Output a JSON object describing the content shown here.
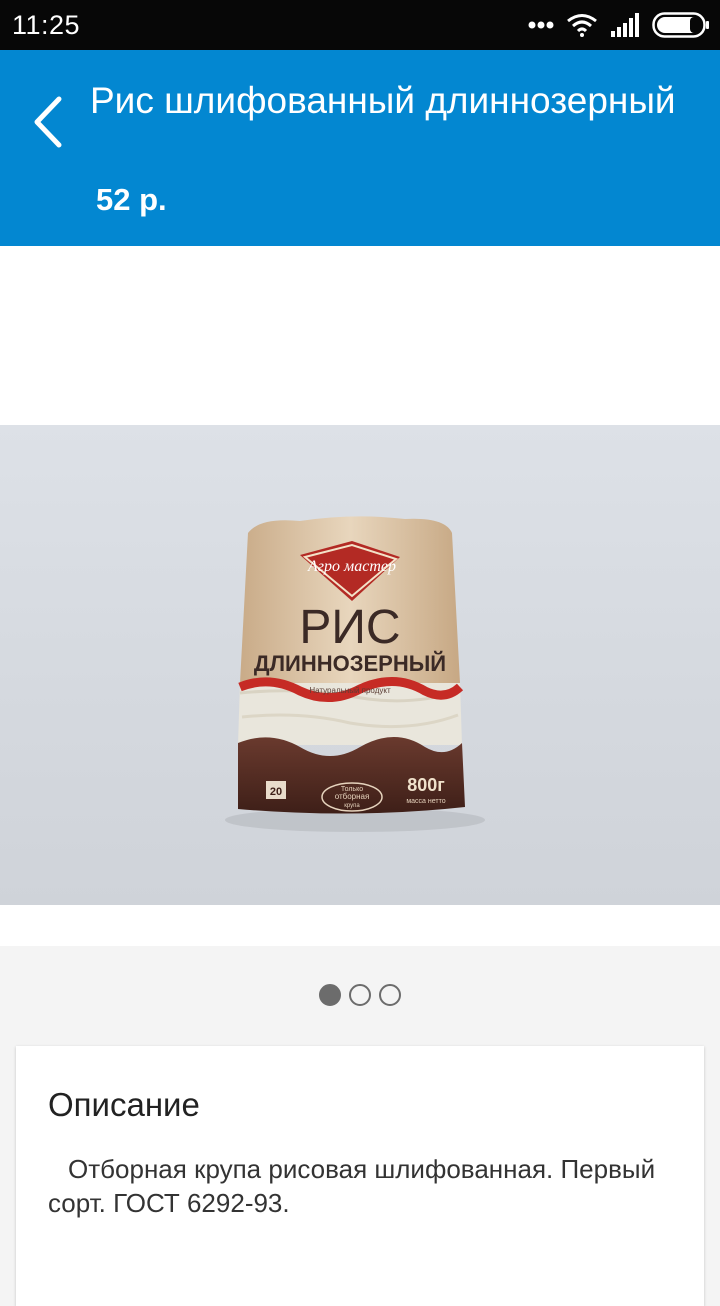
{
  "status_bar": {
    "time": "11:25",
    "icons": [
      "dots-icon",
      "wifi-icon",
      "signal-icon",
      "battery-icon"
    ]
  },
  "header": {
    "title": "Рис шлифованный длиннозерный",
    "price": "52 р.",
    "back_icon": "chevron-left-icon",
    "color": "#0387d1"
  },
  "product_image": {
    "brand": "Агро мастер",
    "name_line1": "РИС",
    "name_line2": "ДЛИННОЗЕРНЫЙ",
    "tagline": "Натуральный продукт",
    "weight": "800г",
    "weight_label": "масса нетто",
    "badge_top": "Только",
    "badge_mid": "отборная",
    "badge_bottom": "крупа",
    "cook_time": "20"
  },
  "pager": {
    "count": 3,
    "active_index": 0
  },
  "description": {
    "heading": "Описание",
    "text": "Отборная крупа рисовая шлифованная. Первый сорт. ГОСТ 6292-93."
  }
}
